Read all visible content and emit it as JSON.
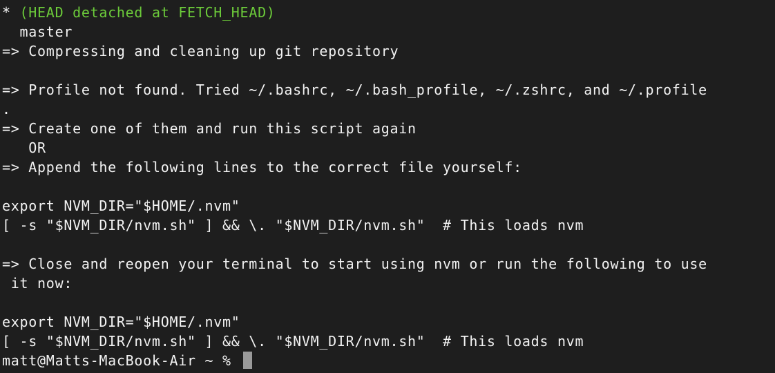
{
  "terminal": {
    "lines": [
      {
        "star": "*",
        "text": " (HEAD detached at FETCH_HEAD)",
        "color": "green"
      },
      {
        "text": "  master"
      },
      {
        "text": "=> Compressing and cleaning up git repository"
      },
      {
        "text": ""
      },
      {
        "text": "=> Profile not found. Tried ~/.bashrc, ~/.bash_profile, ~/.zshrc, and ~/.profile"
      },
      {
        "text": "."
      },
      {
        "text": "=> Create one of them and run this script again"
      },
      {
        "text": "   OR"
      },
      {
        "text": "=> Append the following lines to the correct file yourself:"
      },
      {
        "text": ""
      },
      {
        "text": "export NVM_DIR=\"$HOME/.nvm\""
      },
      {
        "text": "[ -s \"$NVM_DIR/nvm.sh\" ] && \\. \"$NVM_DIR/nvm.sh\"  # This loads nvm"
      },
      {
        "text": ""
      },
      {
        "text": "=> Close and reopen your terminal to start using nvm or run the following to use"
      },
      {
        "text": " it now:"
      },
      {
        "text": ""
      },
      {
        "text": "export NVM_DIR=\"$HOME/.nvm\""
      },
      {
        "text": "[ -s \"$NVM_DIR/nvm.sh\" ] && \\. \"$NVM_DIR/nvm.sh\"  # This loads nvm"
      }
    ],
    "prompt": "matt@Matts-MacBook-Air ~ % ",
    "colors": {
      "background": "#1e1e1e",
      "text": "#f2f2f2",
      "branch": "#6ccb3a",
      "cursor": "#9a9a9a"
    }
  }
}
